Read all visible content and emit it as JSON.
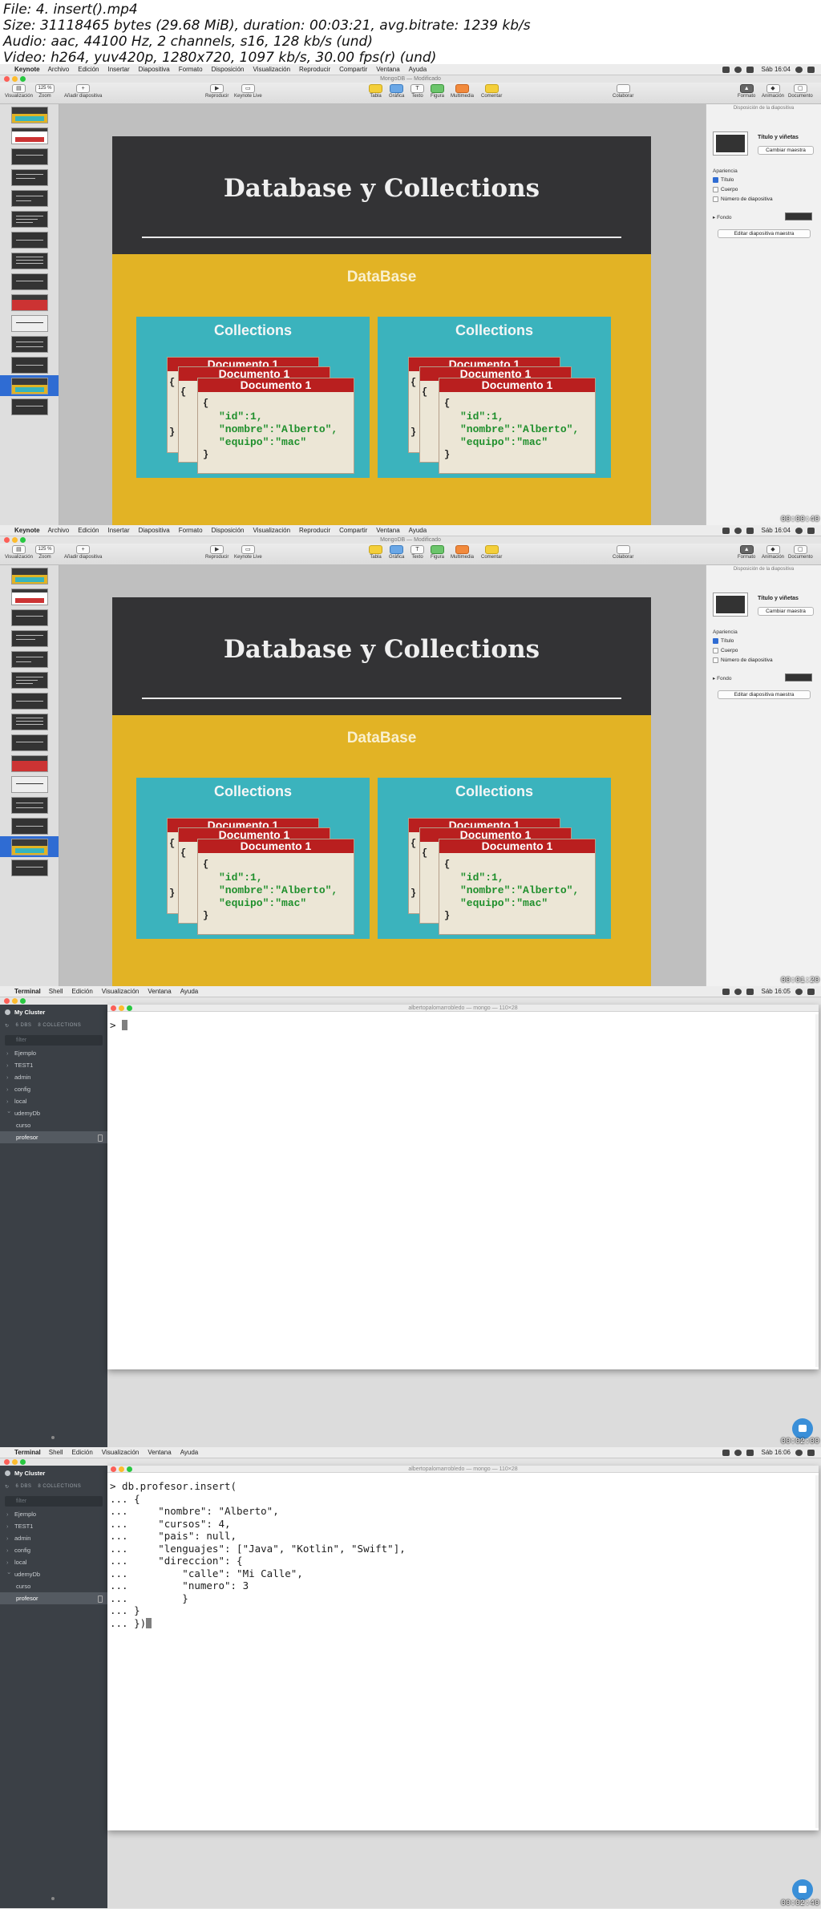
{
  "header": {
    "lines": [
      "File: 4. insert().mp4",
      "Size: 31118465 bytes (29.68 MiB), duration: 00:03:21, avg.bitrate: 1239 kb/s",
      "Audio: aac, 44100 Hz, 2 channels, s16, 128 kb/s (und)",
      "Video: h264, yuv420p, 1280x720, 1097 kb/s, 30.00 fps(r) (und)"
    ]
  },
  "keynote": {
    "menubar": {
      "app": "Keynote",
      "items": [
        "Archivo",
        "Edición",
        "Insertar",
        "Diapositiva",
        "Formato",
        "Disposición",
        "Visualización",
        "Reproducir",
        "Compartir",
        "Ventana",
        "Ayuda"
      ],
      "clock": "Sáb 16:04"
    },
    "window_title": "MongoDB — Modificado",
    "toolbar": {
      "view_label": "Visualización",
      "zoom_value": "125 %",
      "zoom_label": "Zoom",
      "add_slide": "Añadir diapositiva",
      "play": "Reproducir",
      "keynote_live": "Keynote Live",
      "table": "Tabla",
      "chart": "Gráfica",
      "text": "Texto",
      "shape": "Figura",
      "media": "Multimedia",
      "comment": "Comentar",
      "collaborate": "Colaborar",
      "format": "Formato",
      "animate": "Animación",
      "document": "Documento"
    },
    "slide": {
      "title": "Database y Collections",
      "database_label": "DataBase",
      "collection_label": "Collections",
      "doc_back1": "Documento 1",
      "doc_back2": "Documento 1",
      "doc_front": "Documento 1",
      "json_line1": "\"id\":1,",
      "json_line2": "\"nombre\":\"Alberto\",",
      "json_line3": "\"equipo\":\"mac\""
    },
    "inspector": {
      "heading": "Disposición de la diapositiva",
      "master_title": "Título y viñetas",
      "change_master": "Cambiar maestra",
      "appearance": "Apariencia",
      "opt_title": "Título",
      "opt_body": "Cuerpo",
      "opt_number": "Número de diapositiva",
      "background": "Fondo",
      "edit_master": "Editar diapositiva maestra"
    },
    "frame1_time": "00:00:40",
    "frame2_time": "00:01:20"
  },
  "terminal": {
    "menubar": {
      "app": "Terminal",
      "items": [
        "Shell",
        "Edición",
        "Visualización",
        "Ventana",
        "Ayuda"
      ],
      "clock1": "Sáb 16:05",
      "clock2": "Sáb 16:06"
    },
    "window_title": "albertopalomarrobledo — mongo — 110×28",
    "sidebar": {
      "cluster": "My Cluster",
      "dbs_label": "6 DBS",
      "collections_label": "8 COLLECTIONS",
      "filter_placeholder": "filter",
      "items": [
        "Ejemplo",
        "TEST1",
        "admin",
        "config",
        "local",
        "udemyDb"
      ],
      "sub_items": [
        "curso",
        "profesor"
      ]
    },
    "prompt": "> ",
    "command_lines": [
      "> db.profesor.insert(",
      "... {",
      "...     \"nombre\": \"Alberto\",",
      "...     \"cursos\": 4,",
      "...     \"pais\": null,",
      "...     \"lenguajes\": [\"Java\", \"Kotlin\", \"Swift\"],",
      "...     \"direccion\": {",
      "...         \"calle\": \"Mi Calle\",",
      "...         \"numero\": 3",
      "...         }",
      "... }",
      "... })"
    ],
    "frame3_time": "00:02:00",
    "frame4_time": "00:02:40"
  }
}
